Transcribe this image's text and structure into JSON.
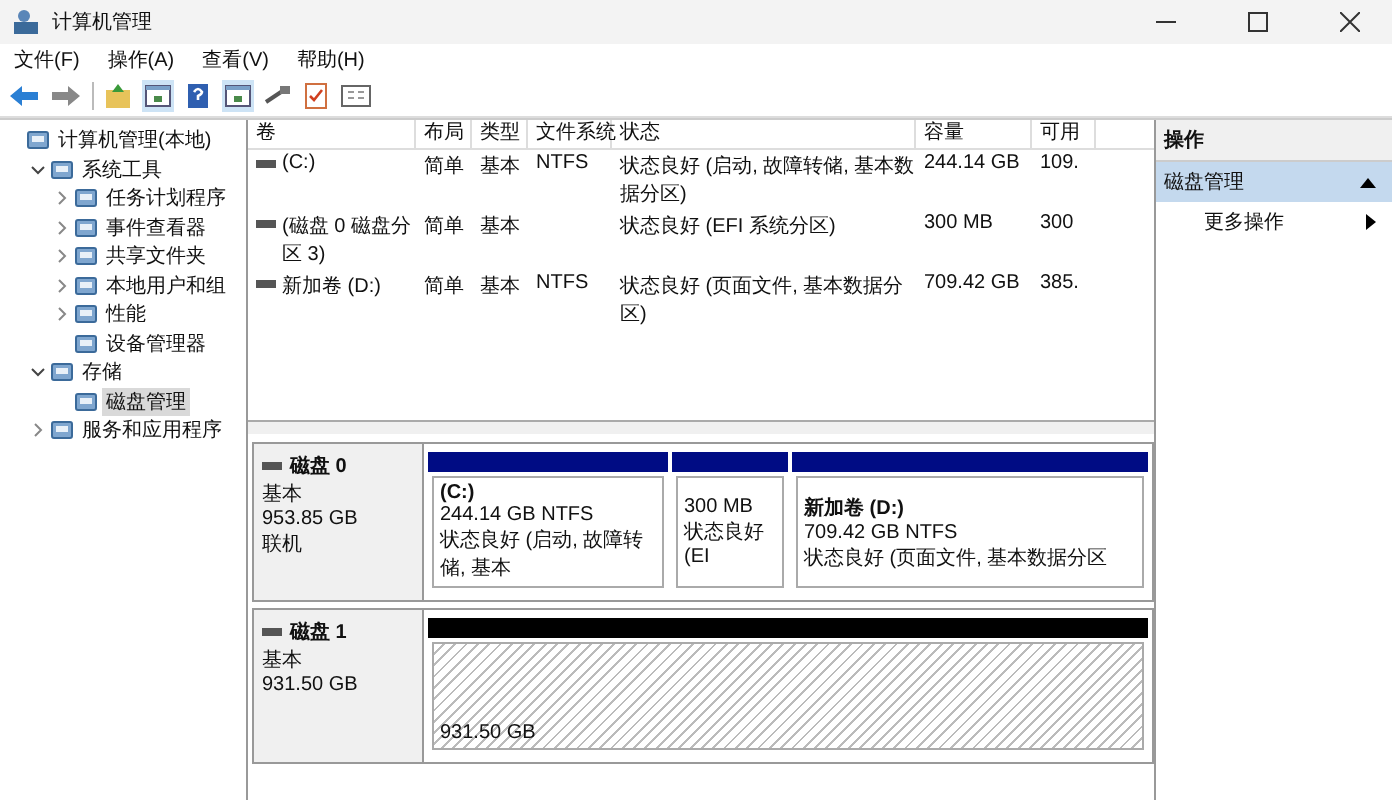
{
  "window": {
    "title": "计算机管理"
  },
  "menu": [
    "文件(F)",
    "操作(A)",
    "查看(V)",
    "帮助(H)"
  ],
  "tree": [
    {
      "label": "计算机管理(本地)",
      "selected": false,
      "children": [
        {
          "label": "系统工具",
          "selected": false,
          "expanded": true,
          "children": [
            {
              "label": "任务计划程序",
              "selected": false,
              "expanded": false
            },
            {
              "label": "事件查看器",
              "selected": false,
              "expanded": false
            },
            {
              "label": "共享文件夹",
              "selected": false,
              "expanded": false
            },
            {
              "label": "本地用户和组",
              "selected": false,
              "expanded": false
            },
            {
              "label": "性能",
              "selected": false,
              "expanded": false
            },
            {
              "label": "设备管理器",
              "selected": false
            }
          ]
        },
        {
          "label": "存储",
          "selected": false,
          "expanded": true,
          "children": [
            {
              "label": "磁盘管理",
              "selected": true
            }
          ]
        },
        {
          "label": "服务和应用程序",
          "selected": false,
          "expanded": false
        }
      ]
    }
  ],
  "table": {
    "columns": [
      "卷",
      "布局",
      "类型",
      "文件系统",
      "状态",
      "容量",
      "可用"
    ],
    "rows": [
      [
        "(C:)",
        "简单",
        "基本",
        "NTFS",
        "状态良好 (启动, 故障转储, 基本数据分区)",
        "244.14 GB",
        "109."
      ],
      [
        "(磁盘 0 磁盘分区 3)",
        "简单",
        "基本",
        "",
        "状态良好 (EFI 系统分区)",
        "300 MB",
        "300"
      ],
      [
        "新加卷 (D:)",
        "简单",
        "基本",
        "NTFS",
        "状态良好 (页面文件, 基本数据分区)",
        "709.42 GB",
        "385."
      ]
    ]
  },
  "disks": [
    {
      "name": "磁盘 0",
      "type": "基本",
      "size": "953.85 GB",
      "status": "联机",
      "partitions": [
        {
          "kind": "primary",
          "label": "(C:)",
          "size": "244.14 GB NTFS",
          "status": "状态良好 (启动, 故障转储, 基本"
        },
        {
          "kind": "primary",
          "size": "300 MB",
          "status": "状态良好 (EI"
        },
        {
          "kind": "primary",
          "label": "新加卷  (D:)",
          "size": "709.42 GB NTFS",
          "status": "状态良好 (页面文件, 基本数据分区"
        }
      ]
    },
    {
      "name": "磁盘 1",
      "type": "基本",
      "size": "931.50 GB",
      "partitions": [
        {
          "kind": "unallocated",
          "size": "931.50 GB"
        }
      ]
    }
  ],
  "actions": {
    "header": "操作",
    "section": "磁盘管理",
    "items": [
      "更多操作"
    ]
  }
}
